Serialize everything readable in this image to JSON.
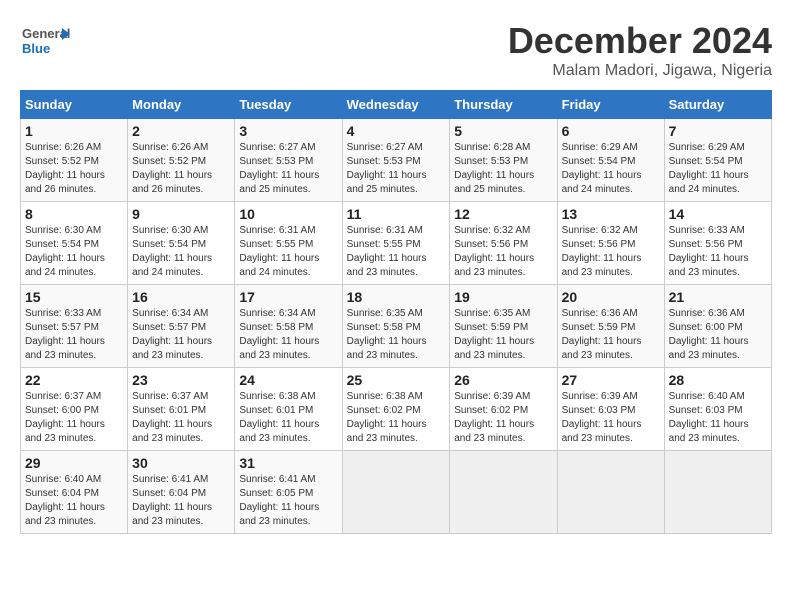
{
  "header": {
    "logo_general": "General",
    "logo_blue": "Blue",
    "month": "December 2024",
    "location": "Malam Madori, Jigawa, Nigeria"
  },
  "weekdays": [
    "Sunday",
    "Monday",
    "Tuesday",
    "Wednesday",
    "Thursday",
    "Friday",
    "Saturday"
  ],
  "weeks": [
    [
      {
        "num": "1",
        "rise": "6:26 AM",
        "set": "5:52 PM",
        "daylight": "11 hours and 26 minutes."
      },
      {
        "num": "2",
        "rise": "6:26 AM",
        "set": "5:52 PM",
        "daylight": "11 hours and 26 minutes."
      },
      {
        "num": "3",
        "rise": "6:27 AM",
        "set": "5:53 PM",
        "daylight": "11 hours and 25 minutes."
      },
      {
        "num": "4",
        "rise": "6:27 AM",
        "set": "5:53 PM",
        "daylight": "11 hours and 25 minutes."
      },
      {
        "num": "5",
        "rise": "6:28 AM",
        "set": "5:53 PM",
        "daylight": "11 hours and 25 minutes."
      },
      {
        "num": "6",
        "rise": "6:29 AM",
        "set": "5:54 PM",
        "daylight": "11 hours and 24 minutes."
      },
      {
        "num": "7",
        "rise": "6:29 AM",
        "set": "5:54 PM",
        "daylight": "11 hours and 24 minutes."
      }
    ],
    [
      {
        "num": "8",
        "rise": "6:30 AM",
        "set": "5:54 PM",
        "daylight": "11 hours and 24 minutes."
      },
      {
        "num": "9",
        "rise": "6:30 AM",
        "set": "5:54 PM",
        "daylight": "11 hours and 24 minutes."
      },
      {
        "num": "10",
        "rise": "6:31 AM",
        "set": "5:55 PM",
        "daylight": "11 hours and 24 minutes."
      },
      {
        "num": "11",
        "rise": "6:31 AM",
        "set": "5:55 PM",
        "daylight": "11 hours and 23 minutes."
      },
      {
        "num": "12",
        "rise": "6:32 AM",
        "set": "5:56 PM",
        "daylight": "11 hours and 23 minutes."
      },
      {
        "num": "13",
        "rise": "6:32 AM",
        "set": "5:56 PM",
        "daylight": "11 hours and 23 minutes."
      },
      {
        "num": "14",
        "rise": "6:33 AM",
        "set": "5:56 PM",
        "daylight": "11 hours and 23 minutes."
      }
    ],
    [
      {
        "num": "15",
        "rise": "6:33 AM",
        "set": "5:57 PM",
        "daylight": "11 hours and 23 minutes."
      },
      {
        "num": "16",
        "rise": "6:34 AM",
        "set": "5:57 PM",
        "daylight": "11 hours and 23 minutes."
      },
      {
        "num": "17",
        "rise": "6:34 AM",
        "set": "5:58 PM",
        "daylight": "11 hours and 23 minutes."
      },
      {
        "num": "18",
        "rise": "6:35 AM",
        "set": "5:58 PM",
        "daylight": "11 hours and 23 minutes."
      },
      {
        "num": "19",
        "rise": "6:35 AM",
        "set": "5:59 PM",
        "daylight": "11 hours and 23 minutes."
      },
      {
        "num": "20",
        "rise": "6:36 AM",
        "set": "5:59 PM",
        "daylight": "11 hours and 23 minutes."
      },
      {
        "num": "21",
        "rise": "6:36 AM",
        "set": "6:00 PM",
        "daylight": "11 hours and 23 minutes."
      }
    ],
    [
      {
        "num": "22",
        "rise": "6:37 AM",
        "set": "6:00 PM",
        "daylight": "11 hours and 23 minutes."
      },
      {
        "num": "23",
        "rise": "6:37 AM",
        "set": "6:01 PM",
        "daylight": "11 hours and 23 minutes."
      },
      {
        "num": "24",
        "rise": "6:38 AM",
        "set": "6:01 PM",
        "daylight": "11 hours and 23 minutes."
      },
      {
        "num": "25",
        "rise": "6:38 AM",
        "set": "6:02 PM",
        "daylight": "11 hours and 23 minutes."
      },
      {
        "num": "26",
        "rise": "6:39 AM",
        "set": "6:02 PM",
        "daylight": "11 hours and 23 minutes."
      },
      {
        "num": "27",
        "rise": "6:39 AM",
        "set": "6:03 PM",
        "daylight": "11 hours and 23 minutes."
      },
      {
        "num": "28",
        "rise": "6:40 AM",
        "set": "6:03 PM",
        "daylight": "11 hours and 23 minutes."
      }
    ],
    [
      {
        "num": "29",
        "rise": "6:40 AM",
        "set": "6:04 PM",
        "daylight": "11 hours and 23 minutes."
      },
      {
        "num": "30",
        "rise": "6:41 AM",
        "set": "6:04 PM",
        "daylight": "11 hours and 23 minutes."
      },
      {
        "num": "31",
        "rise": "6:41 AM",
        "set": "6:05 PM",
        "daylight": "11 hours and 23 minutes."
      },
      null,
      null,
      null,
      null
    ]
  ]
}
